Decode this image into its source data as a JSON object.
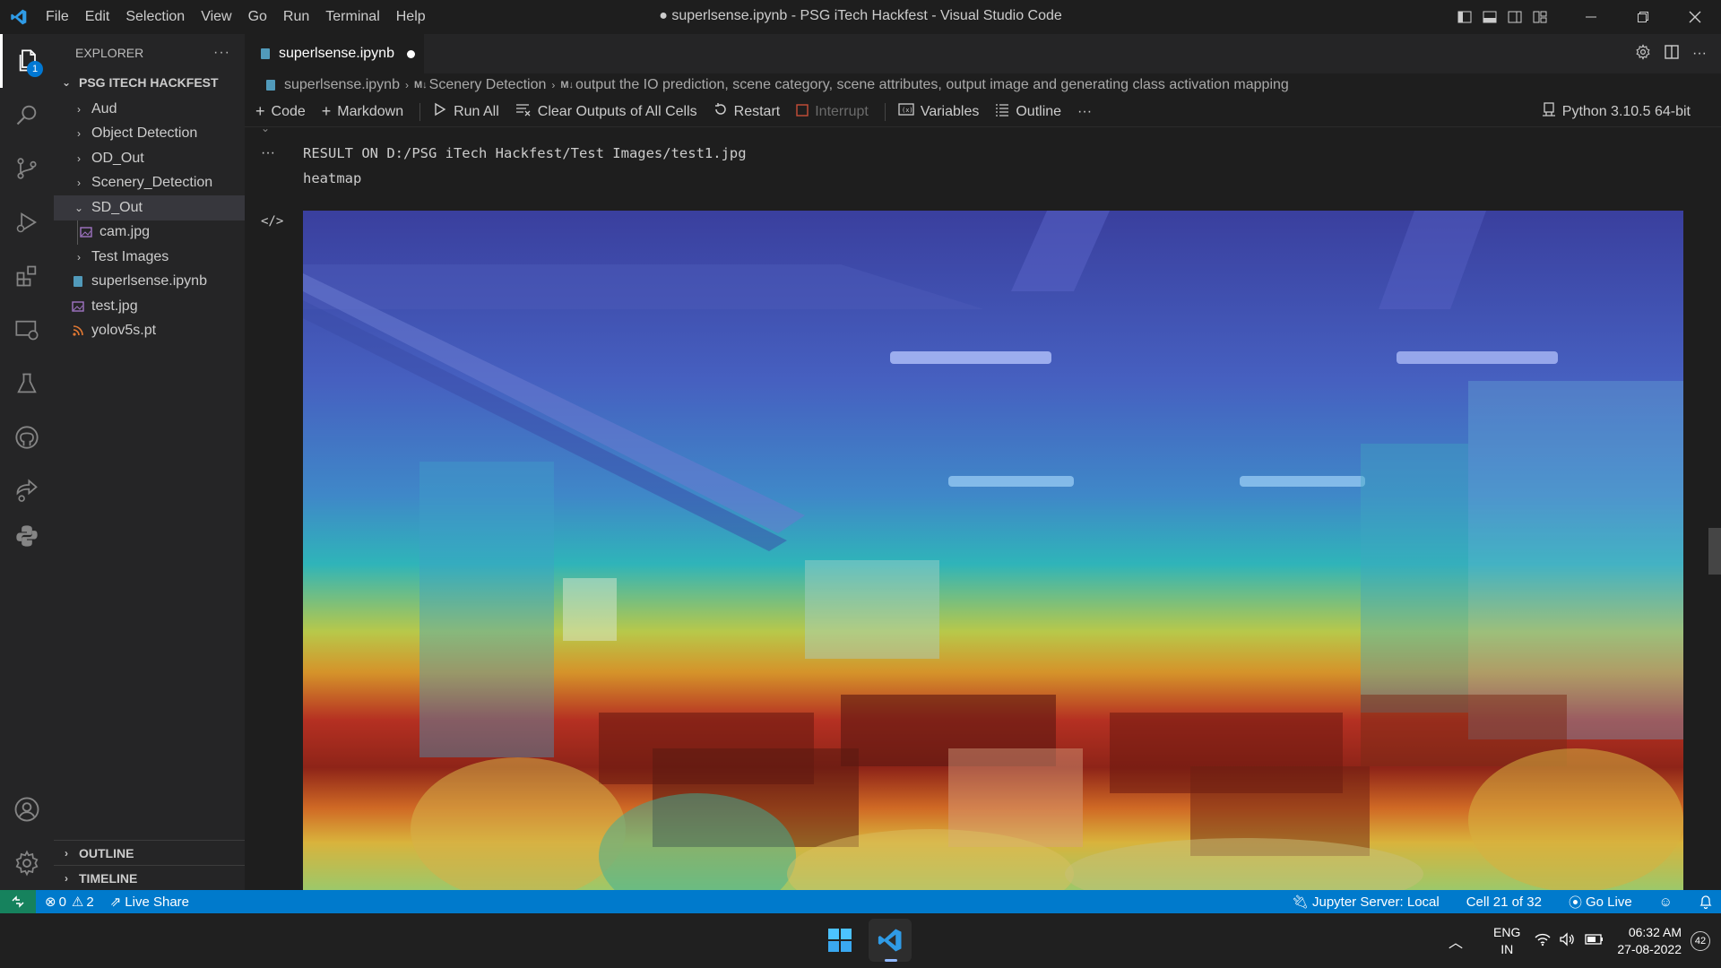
{
  "titlebar": {
    "menu": [
      "File",
      "Edit",
      "Selection",
      "View",
      "Go",
      "Run",
      "Terminal",
      "Help"
    ],
    "window_title": "● superlsense.ipynb - PSG iTech Hackfest - Visual Studio Code"
  },
  "activity": {
    "explorer_badge": "1"
  },
  "explorer": {
    "header": "EXPLORER",
    "more": "···",
    "root": "PSG ITECH HACKFEST",
    "items": [
      {
        "label": "Aud"
      },
      {
        "label": "Object Detection"
      },
      {
        "label": "OD_Out"
      },
      {
        "label": "Scenery_Detection"
      },
      {
        "label": "SD_Out"
      },
      {
        "label": "cam.jpg"
      },
      {
        "label": "Test Images"
      },
      {
        "label": "superlsense.ipynb"
      },
      {
        "label": "test.jpg"
      },
      {
        "label": "yolov5s.pt"
      }
    ],
    "outline": "OUTLINE",
    "timeline": "TIMELINE"
  },
  "tab": {
    "label": "superlsense.ipynb"
  },
  "breadcrumb": {
    "file": "superlsense.ipynb",
    "section": "Scenery Detection",
    "cell": "output the IO prediction, scene category, scene attributes, output image and generating class activation mapping"
  },
  "toolbar": {
    "code": "Code",
    "markdown": "Markdown",
    "run_all": "Run All",
    "clear_outputs": "Clear Outputs of All Cells",
    "restart": "Restart",
    "interrupt": "Interrupt",
    "variables": "Variables",
    "outline": "Outline",
    "more": "···",
    "kernel": "Python 3.10.5 64-bit"
  },
  "output": {
    "gutter_more": "···",
    "line1": "RESULT ON D:/PSG iTech Hackfest/Test Images/test1.jpg",
    "line2": "heatmap"
  },
  "status": {
    "errors": "0",
    "warnings": "2",
    "live_share": "Live Share",
    "jupyter": "Jupyter Server: Local",
    "cell": "Cell 21 of 32",
    "go_live": "Go Live"
  },
  "taskbar": {
    "lang1": "ENG",
    "lang2": "IN",
    "time": "06:32 AM",
    "date": "27-08-2022",
    "notifications": "42"
  },
  "colors": {
    "accent": "#007acc",
    "remote": "#16825d",
    "editor_bg": "#1e1e1e",
    "sidebar_bg": "#252526"
  }
}
